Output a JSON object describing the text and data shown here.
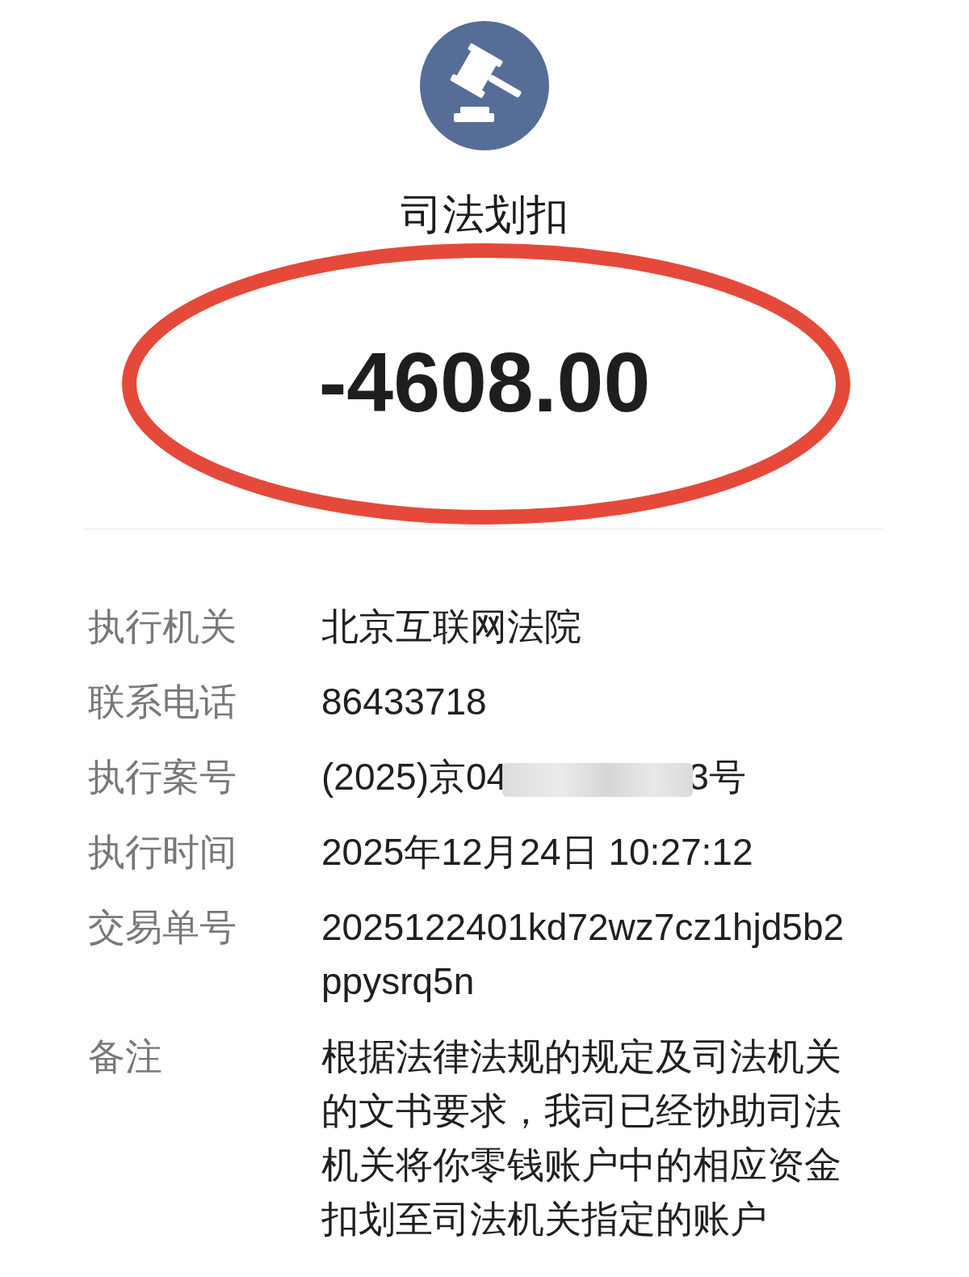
{
  "header": {
    "title": "司法划扣"
  },
  "amount": {
    "value": "-4608.00",
    "circled": true
  },
  "details": [
    {
      "kind": "text",
      "label": "执行机关",
      "value": "北京互联网法院"
    },
    {
      "kind": "text",
      "label": "联系电话",
      "value": "86433718"
    },
    {
      "kind": "redacted",
      "label": "执行案号",
      "value_start": "(2025)京04",
      "value_end": "3号"
    },
    {
      "kind": "text",
      "label": "执行时间",
      "value": "2025年12月24日 10:27:12"
    },
    {
      "kind": "text",
      "label": "交易单号",
      "value": "2025122401kd72wz7cz1hjd5b2ppysrq5n"
    },
    {
      "kind": "text",
      "label": "备注",
      "value": "根据法律法规的规定及司法机关的文书要求，我司已经协助司法机关将你零钱账户中的相应资金扣划至司法机关指定的账户"
    }
  ]
}
